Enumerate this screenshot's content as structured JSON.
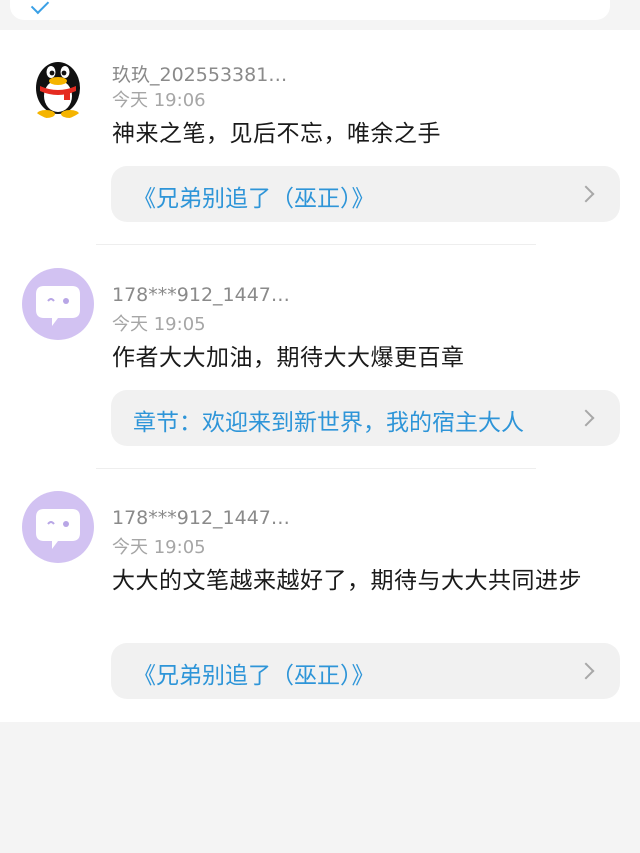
{
  "comments": [
    {
      "username": "玖玖_202553381…",
      "time": "今天 19:06",
      "text": "神来之笔，见后不忘，唯余之手",
      "book": "《兄弟别追了（巫正）》",
      "avatar": "qq-penguin-avatar"
    },
    {
      "username": "178***912_1447…",
      "time": "今天 19:05",
      "text": "作者大大加油，期待大大爆更百章",
      "book": "章节：欢迎来到新世界，我的宿主大人",
      "avatar": "chat-bubble-avatar"
    },
    {
      "username": "178***912_1447…",
      "time": "今天 19:05",
      "text": "大大的文笔越来越好了，期待与大大共同进步",
      "book": "《兄弟别追了（巫正）》",
      "avatar": "chat-bubble-avatar"
    }
  ],
  "colors": {
    "link": "#2e95d8",
    "avatar_purple": "#d2c2f2",
    "background": "#f4f4f4"
  }
}
